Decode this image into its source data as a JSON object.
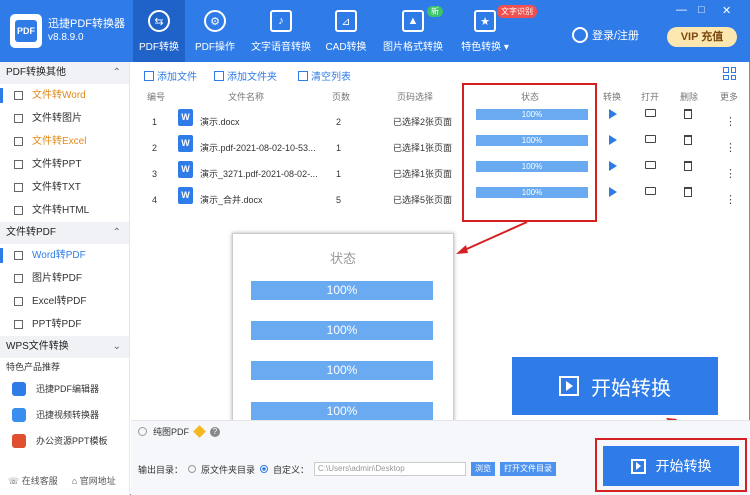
{
  "app": {
    "title": "迅捷PDF转换器",
    "version": "v8.8.9.0",
    "logo_text": "PDF"
  },
  "nav": [
    {
      "label": "PDF转换",
      "icon": "convert-icon"
    },
    {
      "label": "PDF操作",
      "icon": "gear-icon"
    },
    {
      "label": "文字语音转换",
      "icon": "audio-icon"
    },
    {
      "label": "CAD转换",
      "icon": "cad-icon"
    },
    {
      "label": "图片格式转换",
      "icon": "image-icon"
    },
    {
      "label": "特色转换",
      "icon": "star-icon"
    }
  ],
  "badges": {
    "new": "新",
    "ocr": "文字识别"
  },
  "header": {
    "login": "登录/注册",
    "vip": "VIP 充值",
    "controls": [
      "—",
      "□",
      "✕"
    ]
  },
  "sidebar": {
    "sections": [
      {
        "title": "PDF转换其他",
        "items": [
          "文件转Word",
          "文件转图片",
          "文件转Excel",
          "文件转PPT",
          "文件转TXT",
          "文件转HTML"
        ]
      },
      {
        "title": "文件转PDF",
        "items": [
          "Word转PDF",
          "图片转PDF",
          "Excel转PDF",
          "PPT转PDF"
        ]
      },
      {
        "title": "WPS文件转换",
        "items": []
      }
    ],
    "featured_title": "特色产品推荐",
    "products": [
      "迅捷PDF编辑器",
      "迅捷视频转换器",
      "办公资源PPT模板"
    ],
    "footer": [
      "在线客服",
      "官网地址"
    ]
  },
  "toolbar": {
    "add_file": "添加文件",
    "add_folder": "添加文件夹",
    "clear_list": "清空列表"
  },
  "table": {
    "headers": [
      "编号",
      "文件名称",
      "页数",
      "页码选择",
      "状态",
      "转换",
      "打开",
      "删除",
      "更多"
    ],
    "rows": [
      {
        "num": "1",
        "name": "演示.docx",
        "pages": "2",
        "selection": "已选择2张页面",
        "status": "100%"
      },
      {
        "num": "2",
        "name": "演示.pdf-2021-08-02-10-53...",
        "pages": "1",
        "selection": "已选择1张页面",
        "status": "100%"
      },
      {
        "num": "3",
        "name": "演示_3271.pdf-2021-08-02-...",
        "pages": "1",
        "selection": "已选择1张页面",
        "status": "100%"
      },
      {
        "num": "4",
        "name": "演示_合并.docx",
        "pages": "5",
        "selection": "已选择5张页面",
        "status": "100%"
      }
    ]
  },
  "zoom": {
    "title": "状态",
    "bars": [
      "100%",
      "100%",
      "100%",
      "100%"
    ]
  },
  "bottom": {
    "pure_pdf": "纯图PDF",
    "output_label": "输出目录：",
    "opt_original": "原文件夹目录",
    "opt_custom": "自定义：",
    "path": "C:\\Users\\admin\\Desktop",
    "browse": "浏览",
    "open_folder": "打开文件目录",
    "start": "开始转换"
  },
  "colors": {
    "primary": "#2f7ce8",
    "highlight": "#d42020",
    "progress": "#69aaf0"
  }
}
